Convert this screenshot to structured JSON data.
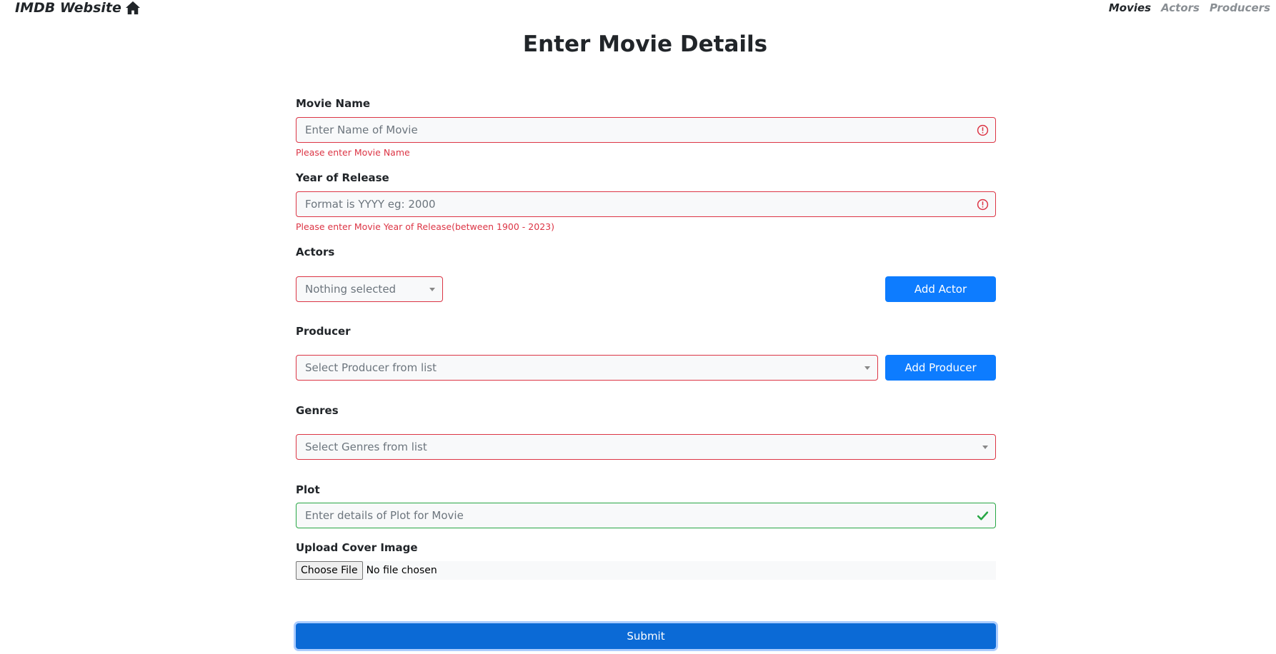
{
  "nav": {
    "brand": "IMDB Website",
    "home_icon": "home-icon",
    "links": [
      {
        "label": "Movies",
        "active": true
      },
      {
        "label": "Actors",
        "active": false
      },
      {
        "label": "Producers",
        "active": false
      }
    ]
  },
  "page": {
    "title": "Enter Movie Details"
  },
  "form": {
    "movie_name": {
      "label": "Movie Name",
      "placeholder": "Enter Name of Movie",
      "error": "Please enter Movie Name",
      "state": "invalid"
    },
    "year": {
      "label": "Year of Release",
      "placeholder": "Format is YYYY eg: 2000",
      "error": "Please enter Movie Year of Release(between 1900 - 2023)",
      "state": "invalid"
    },
    "actors": {
      "label": "Actors",
      "selected": "Nothing selected",
      "add_button": "Add Actor"
    },
    "producer": {
      "label": "Producer",
      "selected": "Select Producer from list",
      "add_button": "Add Producer"
    },
    "genres": {
      "label": "Genres",
      "selected": "Select Genres from list"
    },
    "plot": {
      "label": "Plot",
      "placeholder": "Enter details of Plot for Movie",
      "state": "valid"
    },
    "cover": {
      "label": "Upload Cover Image",
      "button": "Choose File",
      "status": "No file chosen"
    },
    "submit": "Submit"
  },
  "colors": {
    "error": "#dc3545",
    "valid": "#28a745",
    "primary": "#0d7cff",
    "submit": "#0b6ad6"
  }
}
